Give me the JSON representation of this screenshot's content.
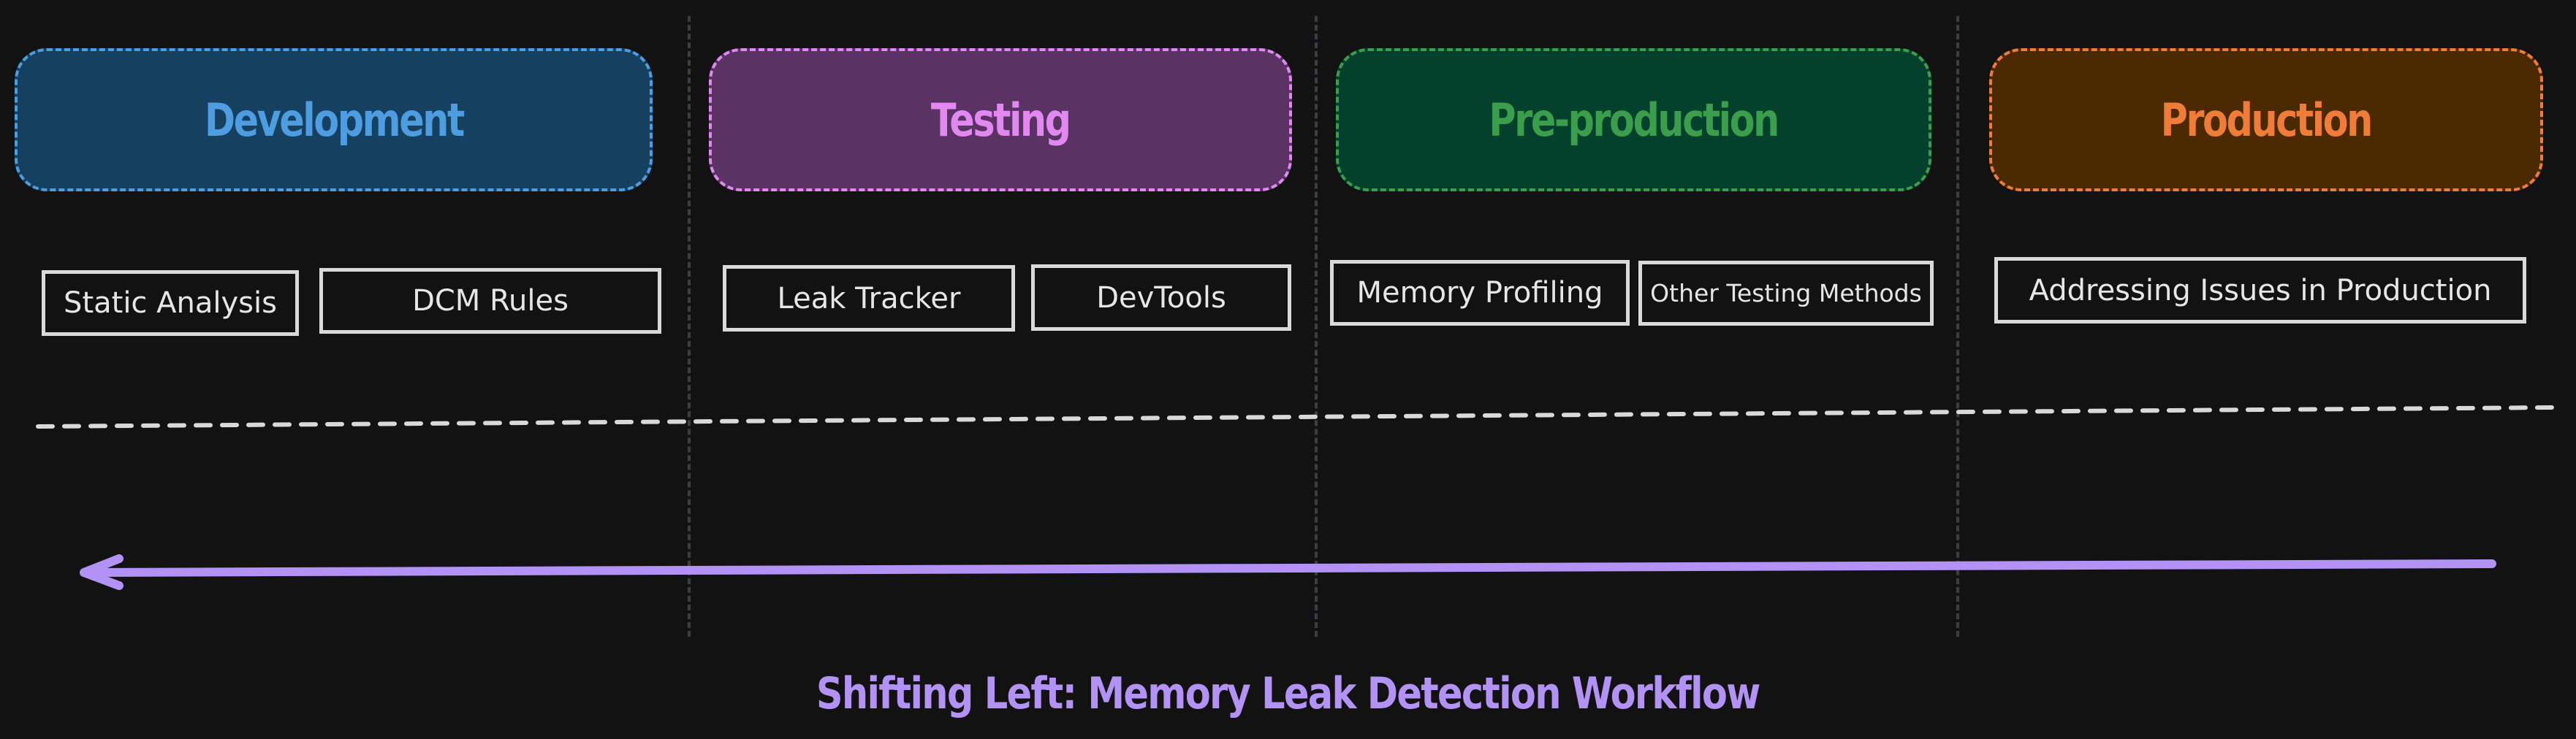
{
  "title": "Shifting Left: Memory Leak Detection Workflow",
  "colors": {
    "background": "#121212",
    "divider": "#3a3f44",
    "tool_border": "#d9d9d9",
    "tool_text": "#e6e6e6",
    "flow_line": "#d9d9d9",
    "arrow": "#b392f5",
    "title": "#b392f5"
  },
  "stages": [
    {
      "name": "Development",
      "fill": "#16405f",
      "border": "#4d9de0",
      "text": "#4d9de0",
      "tools": [
        "Static Analysis",
        "DCM Rules"
      ]
    },
    {
      "name": "Testing",
      "fill": "#5a3264",
      "border": "#e189f0",
      "text": "#e189f0",
      "tools": [
        "Leak Tracker",
        "DevTools"
      ]
    },
    {
      "name": "Pre-production",
      "fill": "#03412c",
      "border": "#3a9e4c",
      "text": "#3a9e4c",
      "tools": [
        "Memory Profiling",
        "Other Testing Methods"
      ]
    },
    {
      "name": "Production",
      "fill": "#4b2a02",
      "border": "#f07c3a",
      "text": "#f07c3a",
      "tools": [
        "Addressing Issues in Production"
      ]
    }
  ],
  "arrow": {
    "direction": "left",
    "label": "shift-left-arrow"
  }
}
